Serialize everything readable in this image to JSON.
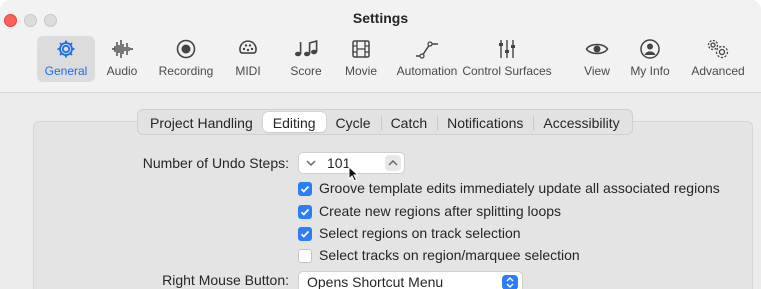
{
  "window": {
    "title": "Settings"
  },
  "toolbar": {
    "items": [
      {
        "label": "General",
        "icon": "gear-icon",
        "active": true
      },
      {
        "label": "Audio",
        "icon": "waveform-icon",
        "active": false
      },
      {
        "label": "Recording",
        "icon": "record-icon",
        "active": false
      },
      {
        "label": "MIDI",
        "icon": "midi-connector-icon",
        "active": false
      },
      {
        "label": "Score",
        "icon": "notes-icon",
        "active": false
      },
      {
        "label": "Movie",
        "icon": "film-icon",
        "active": false
      },
      {
        "label": "Automation",
        "icon": "automation-curve-icon",
        "active": false
      },
      {
        "label": "Control Surfaces",
        "icon": "faders-icon",
        "active": false
      },
      {
        "label": "View",
        "icon": "eye-icon",
        "active": false
      },
      {
        "label": "My Info",
        "icon": "person-icon",
        "active": false
      },
      {
        "label": "Advanced",
        "icon": "gears-icon",
        "active": false
      }
    ],
    "accent_color": "#1a6ee6"
  },
  "tabs": [
    "Project Handling",
    "Editing",
    "Cycle",
    "Catch",
    "Notifications",
    "Accessibility"
  ],
  "selected_tab": "Editing",
  "undo": {
    "label": "Number of Undo Steps:",
    "value": "101"
  },
  "checkboxes": [
    {
      "label": "Groove template edits immediately update all associated regions",
      "checked": true
    },
    {
      "label": "Create new regions after splitting loops",
      "checked": true
    },
    {
      "label": "Select regions on track selection",
      "checked": true
    },
    {
      "label": "Select tracks on region/marquee selection",
      "checked": false
    }
  ],
  "right_mouse": {
    "label": "Right Mouse Button:",
    "value": "Opens Shortcut Menu"
  },
  "colors": {
    "checkbox_on": "#2b7ef5",
    "close_button": "#fe5f57"
  }
}
